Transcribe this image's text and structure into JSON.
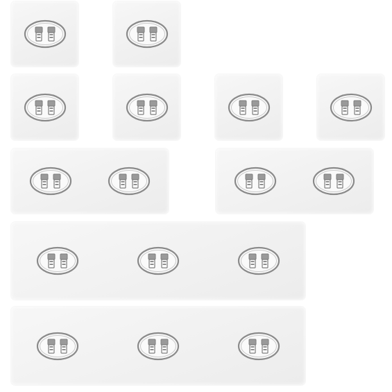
{
  "scene": {
    "background_color": "#ffffff",
    "pad_color": "#f2f2f2",
    "hook_ring_color": "#8a8a8a",
    "hook_clip_color": "#7d7d7d",
    "pads": [
      {
        "id": "pad-1",
        "hooks": 1
      },
      {
        "id": "pad-2",
        "hooks": 1
      },
      {
        "id": "pad-3",
        "hooks": 1
      },
      {
        "id": "pad-4",
        "hooks": 1
      },
      {
        "id": "pad-5",
        "hooks": 1
      },
      {
        "id": "pad-6",
        "hooks": 1
      },
      {
        "id": "pad-7",
        "hooks": 2
      },
      {
        "id": "pad-8",
        "hooks": 2
      },
      {
        "id": "pad-9",
        "hooks": 3
      },
      {
        "id": "pad-10",
        "hooks": 3
      }
    ]
  }
}
